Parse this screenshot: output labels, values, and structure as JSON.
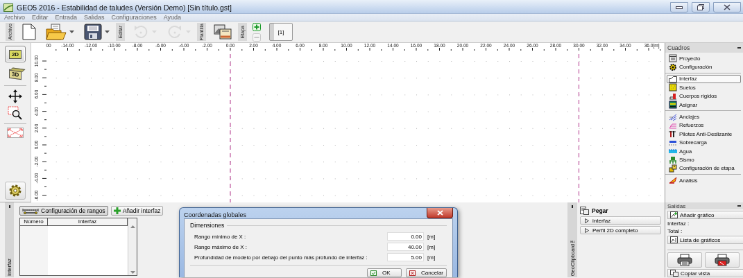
{
  "window": {
    "title": "GEO5 2016 - Estabilidad de taludes (Versión Demo) [Sin título.gst]"
  },
  "menu": [
    "Archivo",
    "Editar",
    "Entrada",
    "Salidas",
    "Configuraciones",
    "Ayuda"
  ],
  "toolbar": {
    "sections": [
      {
        "label": "Archivo",
        "tools": [
          {
            "kind": "new",
            "dropdown": false,
            "disabled": false
          },
          {
            "kind": "open",
            "dropdown": true,
            "disabled": false
          },
          {
            "kind": "save",
            "dropdown": true,
            "disabled": false
          }
        ]
      },
      {
        "label": "Editar",
        "tools": [
          {
            "kind": "undo",
            "dropdown": true,
            "disabled": true
          },
          {
            "kind": "redo",
            "dropdown": true,
            "disabled": true
          }
        ]
      },
      {
        "label": "Plantilla",
        "tools": [
          {
            "kind": "template",
            "dropdown": false,
            "disabled": false
          }
        ]
      },
      {
        "label": "Etapa",
        "tools": [
          {
            "kind": "stage-add",
            "dropdown": false,
            "disabled": false
          },
          {
            "kind": "stage-remove",
            "dropdown": false,
            "disabled": true
          }
        ]
      }
    ],
    "stages": [
      {
        "label": "[1]",
        "selected": true
      }
    ]
  },
  "view_modes": [
    {
      "label": "2D",
      "kind": "plan",
      "selected": true
    },
    {
      "label": "3D",
      "kind": "perspective",
      "selected": false
    }
  ],
  "view_tools": [
    {
      "kind": "pan"
    },
    {
      "kind": "zoom"
    },
    {
      "kind": "fit"
    }
  ],
  "ruler": {
    "x_labels": [
      "00",
      "-14.00",
      "-12.00",
      "-10.00",
      "-8.00",
      "-6.00",
      "-4.00",
      "-2.00",
      "0.00",
      "2.00",
      "4.00",
      "6.00",
      "8.00",
      "10.00",
      "12.00",
      "14.00",
      "16.00",
      "18.00",
      "20.00",
      "22.00",
      "24.00",
      "26.00",
      "28.00",
      "30.00",
      "32.00",
      "34.00",
      "36.0"
    ],
    "unit": "[m]",
    "y_labels": [
      "10.00",
      "8.00",
      "6.00",
      "4.00",
      "2.00",
      "0.00",
      "-2.00",
      "-4.00",
      "-6.00"
    ]
  },
  "cuadros": {
    "title": "Cuadros",
    "groups": [
      {
        "items": [
          {
            "label": "Proyecto",
            "kind": "proyecto",
            "selected": false
          },
          {
            "label": "Configuración",
            "kind": "configuracion",
            "selected": false
          }
        ]
      },
      {
        "items": [
          {
            "label": "Interfaz",
            "kind": "interfaz",
            "selected": true
          },
          {
            "label": "Suelos",
            "kind": "suelos",
            "selected": false
          },
          {
            "label": "Cuerpos rígidos",
            "kind": "cuerpos",
            "selected": false
          },
          {
            "label": "Asignar",
            "kind": "asignar",
            "selected": false
          }
        ]
      },
      {
        "items": [
          {
            "label": "Anclajes",
            "kind": "anclajes",
            "selected": false
          },
          {
            "label": "Refuerzos",
            "kind": "refuerzos",
            "selected": false
          },
          {
            "label": "Pilotes Anti-Deslizante",
            "kind": "pilotes",
            "selected": false
          },
          {
            "label": "Sobrecarga",
            "kind": "sobrecarga",
            "selected": false
          },
          {
            "label": "Agua",
            "kind": "agua",
            "selected": false
          },
          {
            "label": "Sismo",
            "kind": "sismo",
            "selected": false
          },
          {
            "label": "Configuración de etapa",
            "kind": "etapa",
            "selected": false
          }
        ]
      },
      {
        "items": [
          {
            "label": "Análisis",
            "kind": "analisis",
            "selected": false
          }
        ]
      }
    ]
  },
  "interface_panel": {
    "tab": "Interfaz",
    "buttons": [
      {
        "label": "Configuración de rangos",
        "kind": "ranges"
      },
      {
        "label": "Añadir interfaz",
        "kind": "add"
      }
    ],
    "table": {
      "columns": [
        "Número",
        "Interfaz"
      ]
    }
  },
  "dialog": {
    "title": "Coordenadas globales",
    "group": "Dimensiones",
    "fields": [
      {
        "label": "Rango mínimo de X :",
        "value": "0.00",
        "unit": "[m]"
      },
      {
        "label": "Rango máximo de X :",
        "value": "40.00",
        "unit": "[m]"
      },
      {
        "label": "Profundidad de modelo por debajo del punto más profundo de interfaz :",
        "value": "5.00",
        "unit": "[m]"
      }
    ],
    "buttons": [
      {
        "label": "OK",
        "kind": "ok"
      },
      {
        "label": "Cancelar",
        "kind": "cancel"
      }
    ]
  },
  "clipboard": {
    "tab": "GeoClipboard™",
    "title": "Pegar",
    "items": [
      "interfaz",
      "Perfil 2D completo"
    ]
  },
  "salidas": {
    "title": "Salidas",
    "add_button": "Añadir gráfico",
    "labels": [
      "Interfaz :",
      "Total :"
    ],
    "list_button": "Lista de gráficos",
    "print_buttons": [
      {
        "kind": "print"
      },
      {
        "kind": "pdf"
      }
    ],
    "copy_button": "Copiar vista"
  }
}
